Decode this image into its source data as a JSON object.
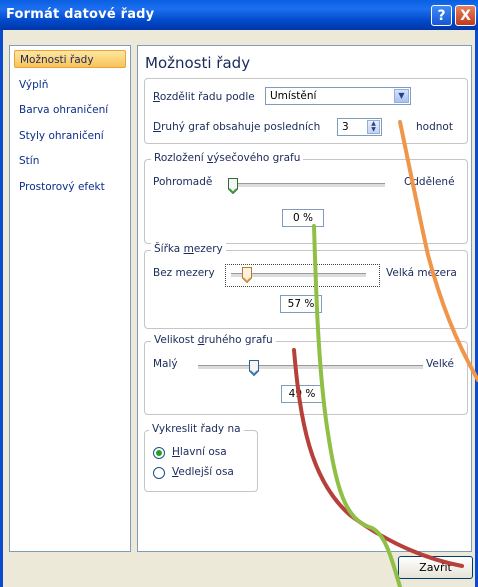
{
  "window": {
    "title": "Formát datové řady",
    "help_glyph": "?",
    "close_glyph": "X"
  },
  "nav": {
    "items": [
      {
        "label": "Možnosti řady",
        "active": true
      },
      {
        "label": "Výplň",
        "active": false
      },
      {
        "label": "Barva ohraničení",
        "active": false
      },
      {
        "label": "Styly ohraničení",
        "active": false
      },
      {
        "label": "Stín",
        "active": false
      },
      {
        "label": "Prostorový efekt",
        "active": false
      }
    ]
  },
  "series_options": {
    "heading": "Možnosti řady",
    "split_label_u": "R",
    "split_label_rest": "ozdělit řadu podle",
    "split_value": "Umístění",
    "second_plot_label_pre": "D",
    "second_plot_label_rest": "ruhý graf obsahuje posledních",
    "second_plot_value": "3",
    "second_plot_unit": "hodnot"
  },
  "explosion": {
    "legend_pre": "Rozložení ",
    "legend_u": "v",
    "legend_rest": "ýsečového grafu",
    "min_label": "Pohromadě",
    "max_label": "Oddělené",
    "value": "0 %",
    "level": 0
  },
  "gap": {
    "legend_pre": "Šířka ",
    "legend_u": "m",
    "legend_rest": "ezery",
    "min_label": "Bez mezery",
    "max_label": "Velká mezera",
    "value": "57 %",
    "level": 0.12
  },
  "second_size": {
    "legend_pre": "Velikost ",
    "legend_u": "d",
    "legend_rest": "ruhého grafu",
    "min_label": "Malý",
    "max_label": "Velké",
    "value": "49 %",
    "level": 0.25
  },
  "plot_on": {
    "legend": "Vykreslit řady na",
    "primary_u": "H",
    "primary_rest": "lavní osa",
    "secondary_u": "V",
    "secondary_rest": "edlejší osa",
    "selected": "primary"
  },
  "footer": {
    "close_label": "Zavřít"
  },
  "colors": {
    "accent": "#0a5fe0",
    "orange_line": "#f0964a",
    "green_line": "#8fbf45",
    "red_line": "#b8403a"
  }
}
